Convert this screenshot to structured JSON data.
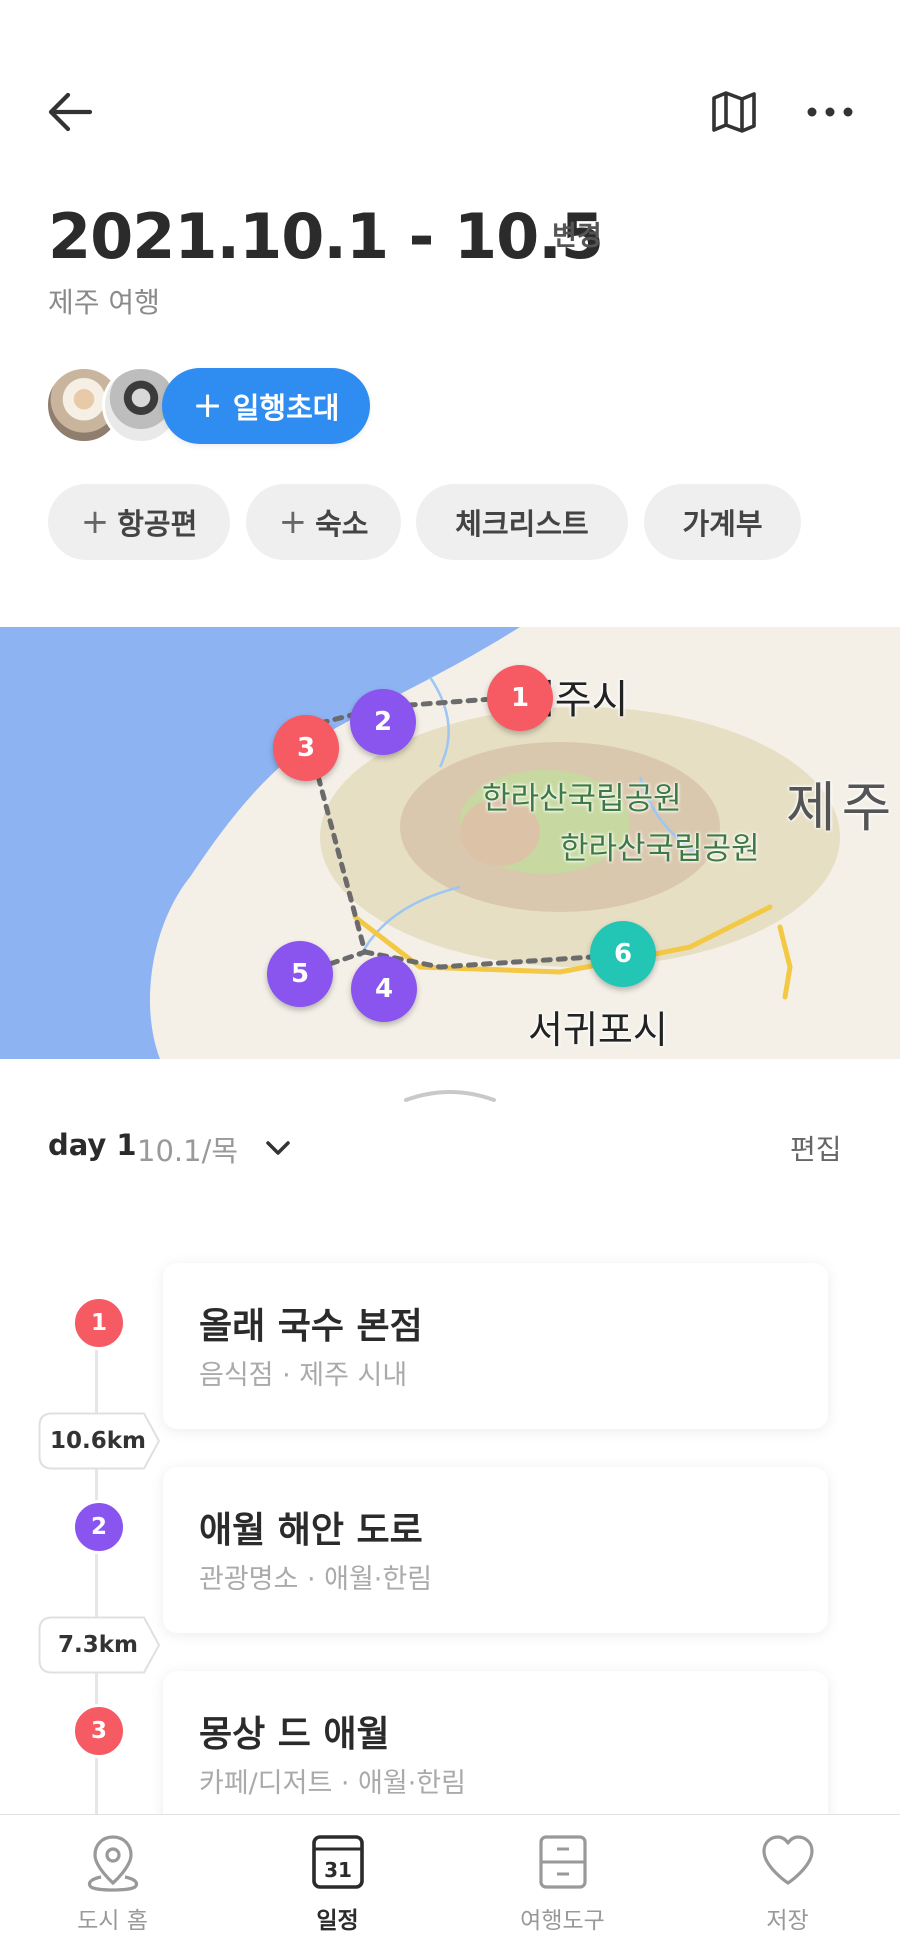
{
  "header": {
    "back_icon": "arrow-left-icon",
    "map_icon": "map-icon",
    "more_icon": "more-horizontal-icon"
  },
  "trip": {
    "date_range": "2021.10.1 - 10.5",
    "change_label": "변경",
    "name": "제주 여행",
    "invite_label": "일행초대"
  },
  "chips": [
    {
      "label": "항공편",
      "has_plus": true
    },
    {
      "label": "숙소",
      "has_plus": true
    },
    {
      "label": "체크리스트",
      "has_plus": false
    },
    {
      "label": "가계부",
      "has_plus": false
    }
  ],
  "map": {
    "labels": {
      "jeju_city": "제주시",
      "park_1": "한라산국립공원",
      "park_2": "한라산국립공원",
      "jeju": "제주",
      "seogwipo": "서귀포시"
    },
    "markers": [
      "1",
      "2",
      "3",
      "4",
      "5",
      "6"
    ]
  },
  "day": {
    "title": "day 1",
    "date": "10.1/목",
    "edit_label": "편집"
  },
  "itinerary": [
    {
      "number": "1",
      "name": "올래 국수 본점",
      "meta": "음식점 · 제주 시내",
      "color": "#f65a63"
    },
    {
      "number": "2",
      "name": "애월 해안 도로",
      "meta": "관광명소 · 애월·한림",
      "color": "#8a55ee"
    },
    {
      "number": "3",
      "name": "몽상 드 애월",
      "meta": "카페/디저트 · 애월·한림",
      "color": "#f65a63"
    }
  ],
  "distances": [
    "10.6km",
    "7.3km"
  ],
  "tabbar": [
    {
      "label": "도시 홈",
      "icon": "location-pin-icon",
      "active": false
    },
    {
      "label": "일정",
      "icon": "calendar-icon",
      "active": true,
      "icon_text": "31"
    },
    {
      "label": "여행도구",
      "icon": "toolbox-icon",
      "active": false
    },
    {
      "label": "저장",
      "icon": "heart-icon",
      "active": false
    }
  ],
  "colors": {
    "accent": "#2f8cf0",
    "marker_red": "#f65a63",
    "marker_purple": "#8a55ee",
    "marker_teal": "#23c6b4"
  }
}
